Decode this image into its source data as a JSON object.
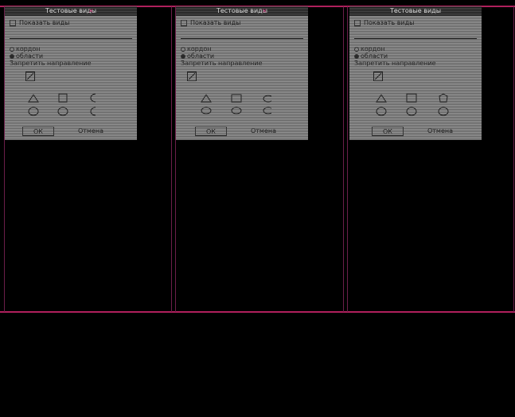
{
  "dialogs": [
    {
      "title": "Тестовые виды",
      "show_label": "Показать виды",
      "radio_contour": "кордон",
      "radio_areas": "области",
      "direction_label": "Запретить направление",
      "ok": "ОК",
      "cancel": "Отмена"
    },
    {
      "title": "Тестовые виды",
      "show_label": "Показать виды",
      "radio_contour": "кордон",
      "radio_areas": "области",
      "direction_label": "Запретить направление",
      "ok": "ОК",
      "cancel": "Отмена"
    },
    {
      "title": "Тестовые виды",
      "show_label": "Показать виды",
      "radio_contour": "кордон",
      "radio_areas": "области",
      "direction_label": "Запретить направление",
      "ok": "ОК",
      "cancel": "Отмена"
    }
  ],
  "colors": {
    "background": "#000000",
    "frame_line": "#b0205c",
    "panel": "#8c8c8c",
    "title_bar": "#3a3a3a"
  },
  "icons": [
    "checkbox-icon",
    "radio-icon",
    "direction-icon",
    "triangle-icon",
    "square-icon",
    "octagon-icon",
    "circle-icon",
    "close-icon"
  ]
}
